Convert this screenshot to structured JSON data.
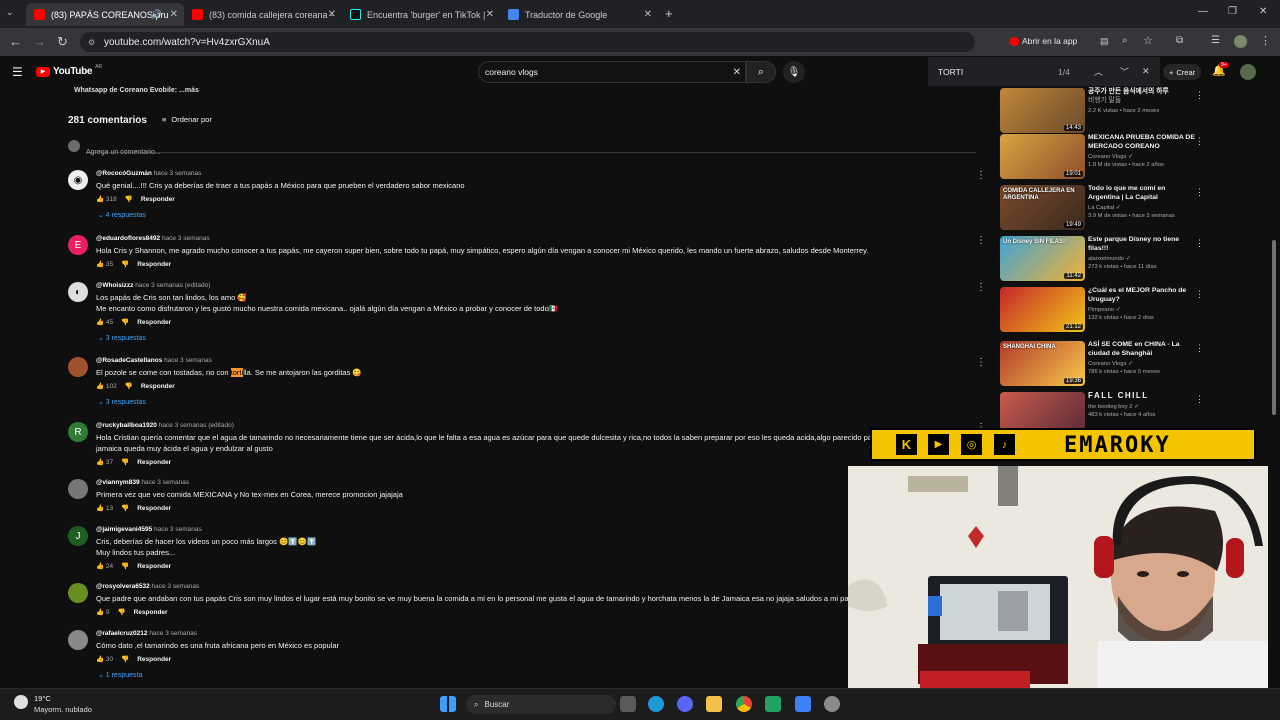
{
  "browser": {
    "tabs": [
      {
        "label": "(83) PAPÁS COREANOS pru",
        "fav_color": "#ff0000"
      },
      {
        "label": "(83) comida callejera coreana -",
        "fav_color": "#ff0000"
      },
      {
        "label": "Encuentra 'burger' en TikTok | ",
        "fav_color": "#111111"
      },
      {
        "label": "Traductor de Google",
        "fav_color": "#4285f4"
      }
    ],
    "url": "youtube.com/watch?v=Hv4zxrGXnuA",
    "open_in_app": "Abrir en la app"
  },
  "youtube": {
    "logo": "YouTube",
    "region": "AR",
    "search_value": "coreano vlogs",
    "create_label": "Crear",
    "notif_count": "9+"
  },
  "find": {
    "query": "TORTI",
    "count": "1/4"
  },
  "description_tail": "Whatsapp de Coreano Evobile: ...más",
  "comments_header": {
    "count": "281 comentarios",
    "sort": "Ordenar por",
    "add_placeholder": "Agrega un comentario..."
  },
  "comments": [
    {
      "author": "@RococóGuzmán",
      "time": "hace 3 semanas",
      "text": [
        "Qué genial....!!! Cris ya deberías de traer a tus papás a México para que prueben el verdadero sabor mexicano"
      ],
      "likes": "318",
      "reply": "Responder",
      "replies": "4 respuestas",
      "avatar_color": "#eeeeee",
      "avatar_letter": "◉"
    },
    {
      "author": "@eduardoflores8492",
      "time": "hace 3 semanas",
      "text": [
        "Hola Cris y Shannon, me agrado mucho conocer a tus papás, me cayeron super bien, sobre todo tu papá, muy simpático, espero algún día vengan a conocer mi México querido, les mando un fuerte abrazo, saludos desde Monterrey."
      ],
      "likes": "35",
      "reply": "Responder",
      "replies": "",
      "avatar_color": "#e91e63",
      "avatar_letter": "E"
    },
    {
      "author": "@Whoisizzz",
      "time": "hace 3 semanas (editado)",
      "text": [
        "Los papás de Cris son tan lindos, los amo 🥰",
        "Me encanto como disfrutaron y les gustó mucho nuestra comida mexicana.. ojalá algún día vengan a México a probar y conocer de todo🇲🇽"
      ],
      "likes": "45",
      "reply": "Responder",
      "replies": "3 respuestas",
      "avatar_color": "#dddddd",
      "avatar_letter": "◐"
    },
    {
      "author": "@RosadeCastellanos",
      "time": "hace 3 semanas",
      "text_pre": "El pozole se come con tostadas, no con ",
      "text_hl": "torti",
      "text_post": "lla. Se me antojaron las gorditas 😋",
      "likes": "102",
      "reply": "Responder",
      "replies": "3 respuestas",
      "avatar_color": "#a0522d",
      "avatar_letter": ""
    },
    {
      "author": "@ruckyballboa1920",
      "time": "hace 3 semanas (editado)",
      "text": [
        "Hola Cristian quería comentar que el agua de tamarindo no necesariamente tiene que ser ácida,lo que le falta a esa agua es azúcar para que quede  dulcesita y rica,no todos la saben preparar por eso les queda acida,algo parecido pasa con el agua de",
        "jamaica queda muy ácida el agua y endulzar al gusto"
      ],
      "likes": "37",
      "reply": "Responder",
      "replies": "",
      "avatar_color": "#2e7d32",
      "avatar_letter": "R"
    },
    {
      "author": "@viannym839",
      "time": "hace 3 semanas",
      "text": [
        "Primera vez que veo comida MEXICANA y No tex-mex en Corea, merece promocion jajajaja"
      ],
      "likes": "13",
      "reply": "Responder",
      "replies": "",
      "avatar_color": "#777777",
      "avatar_letter": ""
    },
    {
      "author": "@jaimigevani4595",
      "time": "hace 3 semanas",
      "text": [
        "Cris, deberías de hacer los videos un poco más largos 😊⬆️😊⬆️",
        "Muy lindos tus padres..."
      ],
      "likes": "24",
      "reply": "Responder",
      "replies": "",
      "avatar_color": "#1b5e20",
      "avatar_letter": "J"
    },
    {
      "author": "@rosyolvera6532",
      "time": "hace 3 semanas",
      "text": [
        "Que padre que andaban con tus papás Cris son muy lindos el lugar está muy bonito se ve muy buena la comida a mi en lo personal me gusta el agua de tamarindo y horchata menos la de Jamaica esa no jajaja saludos a mi pareja favorita me"
      ],
      "likes": "9",
      "reply": "Responder",
      "replies": "",
      "avatar_color": "#6b8e23",
      "avatar_letter": ""
    },
    {
      "author": "@rafaelcruz0212",
      "time": "hace 3 semanas",
      "text": [
        "Cómo dato ,el tamarindo es una fruta africana pero en México es popular"
      ],
      "likes": "30",
      "reply": "Responder",
      "replies": "1 respuesta",
      "avatar_color": "#888888",
      "avatar_letter": ""
    }
  ],
  "sidebar": [
    {
      "title": "[unreadable Korean title] 비행기 말들",
      "channel": "",
      "meta": "2.2 K vistas • hace 2 meses",
      "dur": "14:43",
      "c1": "#c0883a",
      "c2": "#6b4a2a",
      "title_line1": "공주가 만든 음식에서의 하루",
      "title_line2": "비행기 말들"
    },
    {
      "title": "MEXICANA PRUEBA COMIDA DE MERCADO COREANO",
      "channel": "Coreano Vlogs",
      "meta": "1.9 M de vistas • hace 2 años",
      "dur": "19:01",
      "c1": "#d9a441",
      "c2": "#8c4f2b"
    },
    {
      "title": "Todo lo que me comí en Argentina | La Capital",
      "channel": "La Capital",
      "meta": "3.9 M de vistas • hace 3 semanas",
      "dur": "19:49",
      "c1": "#7a4a2a",
      "c2": "#3b2a1f",
      "banner": "COMIDA CALLEJERA EN ARGENTINA"
    },
    {
      "title": "Este parque Disney no tiene filas!!!",
      "channel": "alanxelmundo",
      "meta": "273 k vistas • hace 11 días",
      "dur": "11:42",
      "c1": "#3fa3d6",
      "c2": "#f2b233",
      "banner": "Un Disney SIN FILAS!!"
    },
    {
      "title": "¿Cuál es el MEJOR Pancho de Uruguay?",
      "channel": "Pimpeano",
      "meta": "132 k vistas • hace 2 días",
      "dur": "21:12",
      "c1": "#c62828",
      "c2": "#f0c419"
    },
    {
      "title": "ASÍ SE COME en CHINA - La ciudad de Shanghái",
      "channel": "Coreano Vlogs",
      "meta": "786 k vistas • hace 5 meses",
      "dur": "19:36",
      "c1": "#b23b2e",
      "c2": "#f7c948",
      "banner": "SHANGHAI CHINA"
    },
    {
      "title": "FALL CHILL",
      "channel": "the bootleg boy 2",
      "meta": "483 k vistas • hace 4 años",
      "dur": "",
      "c1": "#c75b4a",
      "c2": "#5a2a3a"
    }
  ],
  "overlay": {
    "name": "EMAROKY"
  },
  "taskbar": {
    "temp": "19°C",
    "weather": "Mayorm. nublado",
    "search": "Buscar"
  }
}
